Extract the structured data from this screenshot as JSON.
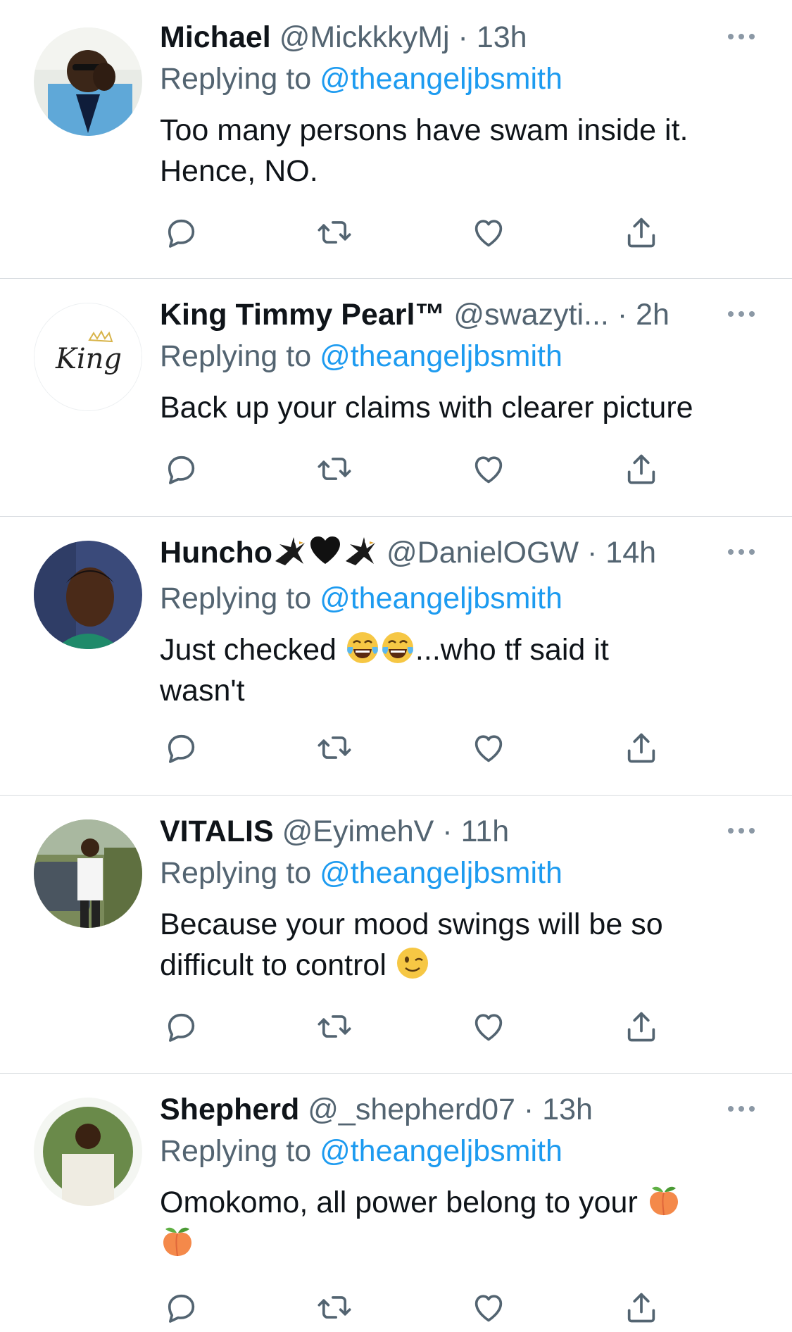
{
  "tweets": [
    {
      "name": "Michael",
      "handle": "@MickkkyMj",
      "dot": "·",
      "time": "13h",
      "replying_prefix": "Replying to ",
      "replying_handle": "@theangeljbsmith",
      "body_line1": "Too many persons have swam inside it.",
      "body_line2": "Hence, NO."
    },
    {
      "name": "King Timmy Pearl™",
      "handle": "@swazyti...",
      "dot": "·",
      "time": "2h",
      "replying_prefix": "Replying to ",
      "replying_handle": "@theangeljbsmith",
      "body_line1": "Back up your claims with clearer picture",
      "avatar_text": "King"
    },
    {
      "name": "Huncho",
      "handle": "@DanielOGW",
      "dot": "·",
      "time": "14h",
      "replying_prefix": "Replying to ",
      "replying_handle": "@theangeljbsmith",
      "body_part1": "Just checked ",
      "body_part2": "...who tf said it",
      "body_line2": "wasn't"
    },
    {
      "name": "VITALIS",
      "handle": "@EyimehV",
      "dot": "·",
      "time": "11h",
      "replying_prefix": "Replying to ",
      "replying_handle": "@theangeljbsmith",
      "body_line1": "Because your mood swings will be so",
      "body_line2": "difficult to control "
    },
    {
      "name": "Shepherd",
      "handle": "@_shepherd07",
      "dot": "·",
      "time": "13h",
      "replying_prefix": "Replying to ",
      "replying_handle": "@theangeljbsmith",
      "body_line1": "Omokomo, all power belong to your "
    }
  ],
  "icons": {
    "reply": "reply-icon",
    "retweet": "retweet-icon",
    "like": "like-icon",
    "share": "share-icon",
    "more": "more-icon"
  },
  "colors": {
    "link": "#1d9bf0",
    "secondary": "#536471",
    "icon": "#536471",
    "divider": "#d7dbdf"
  }
}
